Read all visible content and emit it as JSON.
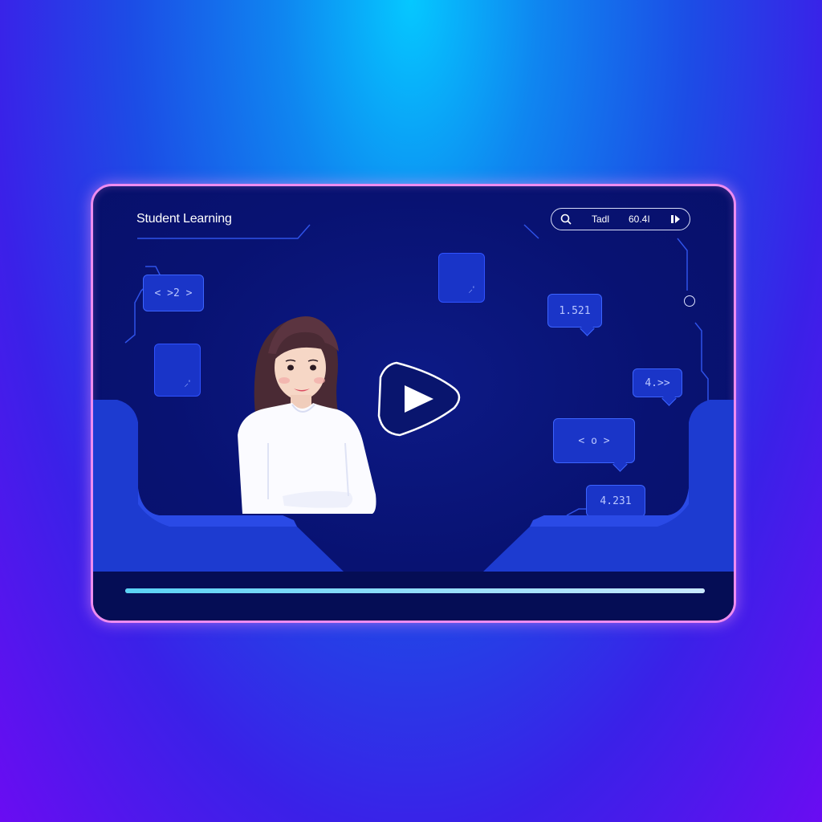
{
  "window": {
    "title": "Student Learning"
  },
  "toolbar": {
    "search_icon": "search-icon",
    "label": "Tadl",
    "count": "60.4I",
    "audio_icon": "volume-icon"
  },
  "overlays": {
    "code_bubble": "< >2 >",
    "stat_top": "1.521",
    "nav_right": "4.>>",
    "nav_controls": "< o >",
    "stat_bottom": "4.231",
    "tile_mark_1": "⸝'",
    "tile_mark_2": "⸝'"
  },
  "player": {
    "play_icon": "play-icon",
    "progress": 1.0
  },
  "colors": {
    "frame": "#ee8cf0",
    "panel": "#081272",
    "accent": "#1a35c8",
    "progress_fill": "#5ad2f5"
  }
}
